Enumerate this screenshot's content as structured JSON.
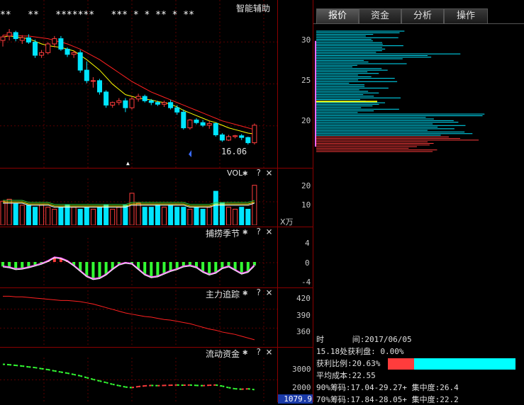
{
  "main_chart": {
    "title": "智能辅助",
    "stars": "**   **   *******   *** * * ** * **",
    "low_label": "16.06",
    "candles": [
      {
        "o": 28.0,
        "h": 28.6,
        "l": 27.3,
        "c": 28.4
      },
      {
        "o": 28.5,
        "h": 29.3,
        "l": 28.0,
        "c": 28.9
      },
      {
        "o": 28.9,
        "h": 29.1,
        "l": 27.9,
        "c": 28.2
      },
      {
        "o": 28.0,
        "h": 28.6,
        "l": 27.6,
        "c": 28.3
      },
      {
        "o": 28.3,
        "h": 28.7,
        "l": 27.6,
        "c": 27.8
      },
      {
        "o": 27.8,
        "h": 28.1,
        "l": 26.0,
        "c": 26.3
      },
      {
        "o": 26.3,
        "h": 26.9,
        "l": 26.0,
        "c": 26.6
      },
      {
        "o": 26.6,
        "h": 27.8,
        "l": 26.4,
        "c": 27.6
      },
      {
        "o": 27.6,
        "h": 28.5,
        "l": 27.2,
        "c": 28.2
      },
      {
        "o": 28.2,
        "h": 28.5,
        "l": 26.8,
        "c": 27.0
      },
      {
        "o": 27.0,
        "h": 27.2,
        "l": 26.1,
        "c": 26.4
      },
      {
        "o": 26.4,
        "h": 26.8,
        "l": 26.0,
        "c": 26.6
      },
      {
        "o": 26.6,
        "h": 26.9,
        "l": 24.3,
        "c": 24.6
      },
      {
        "o": 24.6,
        "h": 25.6,
        "l": 23.1,
        "c": 23.4
      },
      {
        "o": 23.4,
        "h": 23.8,
        "l": 22.6,
        "c": 23.4
      },
      {
        "o": 23.4,
        "h": 23.6,
        "l": 21.8,
        "c": 22.1
      },
      {
        "o": 22.1,
        "h": 22.3,
        "l": 20.3,
        "c": 20.6
      },
      {
        "o": 20.6,
        "h": 21.0,
        "l": 20.3,
        "c": 20.9
      },
      {
        "o": 20.9,
        "h": 21.4,
        "l": 20.6,
        "c": 21.1
      },
      {
        "o": 21.1,
        "h": 21.4,
        "l": 19.8,
        "c": 20.3
      },
      {
        "o": 20.3,
        "h": 21.6,
        "l": 20.1,
        "c": 21.3
      },
      {
        "o": 21.3,
        "h": 21.9,
        "l": 21.0,
        "c": 21.6
      },
      {
        "o": 21.6,
        "h": 21.8,
        "l": 20.9,
        "c": 21.1
      },
      {
        "o": 21.1,
        "h": 21.3,
        "l": 20.6,
        "c": 20.9
      },
      {
        "o": 20.9,
        "h": 21.1,
        "l": 20.5,
        "c": 20.7
      },
      {
        "o": 20.7,
        "h": 21.1,
        "l": 20.4,
        "c": 20.9
      },
      {
        "o": 20.9,
        "h": 21.2,
        "l": 20.1,
        "c": 20.3
      },
      {
        "o": 20.3,
        "h": 20.6,
        "l": 19.5,
        "c": 19.8
      },
      {
        "o": 19.8,
        "h": 20.1,
        "l": 17.8,
        "c": 18.0
      },
      {
        "o": 18.0,
        "h": 19.0,
        "l": 17.8,
        "c": 18.9
      },
      {
        "o": 18.9,
        "h": 19.1,
        "l": 18.4,
        "c": 18.6
      },
      {
        "o": 18.6,
        "h": 18.9,
        "l": 18.1,
        "c": 18.3
      },
      {
        "o": 18.3,
        "h": 18.8,
        "l": 17.9,
        "c": 18.5
      },
      {
        "o": 18.5,
        "h": 18.6,
        "l": 17.0,
        "c": 17.2
      },
      {
        "o": 17.2,
        "h": 17.4,
        "l": 16.4,
        "c": 16.6
      },
      {
        "o": 16.6,
        "h": 17.2,
        "l": 16.5,
        "c": 17.0
      },
      {
        "o": 17.0,
        "h": 17.2,
        "l": 16.8,
        "c": 17.1
      },
      {
        "o": 17.1,
        "h": 17.3,
        "l": 16.6,
        "c": 16.9
      },
      {
        "o": 16.9,
        "h": 17.0,
        "l": 16.1,
        "c": 16.3
      },
      {
        "o": 16.3,
        "h": 18.5,
        "l": 16.1,
        "c": 18.3
      }
    ],
    "ma_short": [
      28.4,
      28.5,
      28.4,
      28.3,
      28.2,
      27.9,
      27.6,
      27.4,
      27.3,
      27.2,
      27.0,
      26.8,
      26.3,
      25.8,
      25.2,
      24.6,
      23.8,
      23.0,
      22.4,
      21.8,
      21.6,
      21.4,
      21.3,
      21.2,
      21.0,
      20.9,
      20.7,
      20.4,
      20.0,
      19.7,
      19.4,
      19.1,
      18.8,
      18.6,
      18.3,
      18.0,
      17.8,
      17.6,
      17.4,
      17.3
    ],
    "ma_long": [
      28.6,
      28.6,
      28.6,
      28.5,
      28.5,
      28.4,
      28.3,
      28.2,
      28.0,
      27.8,
      27.6,
      27.3,
      27.0,
      26.6,
      26.2,
      25.8,
      25.3,
      24.8,
      24.3,
      23.8,
      23.3,
      22.9,
      22.5,
      22.1,
      21.8,
      21.5,
      21.2,
      20.9,
      20.6,
      20.3,
      20.0,
      19.7,
      19.4,
      19.1,
      18.8,
      18.6,
      18.4,
      18.2,
      18.0,
      17.8
    ]
  },
  "volume": {
    "title": "VOL",
    "unit": "X万",
    "y_ticks": [
      "20",
      "10"
    ],
    "values": [
      12,
      13,
      11,
      10,
      10,
      9,
      10,
      9,
      8,
      9,
      10,
      9,
      8,
      9,
      8,
      9,
      10,
      8,
      9,
      10,
      16,
      11,
      9,
      9,
      10,
      9,
      10,
      9,
      9,
      8,
      9,
      8,
      9,
      17,
      11,
      9,
      8,
      9,
      8,
      20
    ],
    "ma": [
      11,
      11,
      11,
      11,
      10,
      10,
      10,
      10,
      9,
      9,
      9,
      9,
      9,
      9,
      9,
      9,
      9,
      9,
      9,
      9,
      10,
      10,
      10,
      10,
      10,
      10,
      10,
      10,
      10,
      9,
      9,
      9,
      9,
      10,
      10,
      10,
      10,
      10,
      10,
      11
    ]
  },
  "season": {
    "title": "捕捞季节",
    "y_ticks": [
      "4",
      "0",
      "-4"
    ],
    "values": [
      -1.0,
      -1.2,
      -1.6,
      -1.5,
      -1.2,
      -0.8,
      -0.4,
      0.2,
      1.0,
      0.8,
      0.2,
      -0.8,
      -2.0,
      -3.2,
      -3.8,
      -3.6,
      -2.8,
      -1.6,
      -0.6,
      -0.2,
      -0.4,
      -1.6,
      -2.8,
      -3.4,
      -3.2,
      -2.6,
      -2.0,
      -1.6,
      -1.0,
      -0.8,
      -1.2,
      -2.2,
      -2.8,
      -2.4,
      -1.4,
      -1.0,
      -1.8,
      -2.6,
      -2.2,
      -0.8
    ],
    "line_a": [
      -0.9,
      -1.1,
      -1.5,
      -1.4,
      -1.1,
      -0.7,
      -0.3,
      0.3,
      1.1,
      0.9,
      0.3,
      -0.7,
      -1.9,
      -3.1,
      -3.7,
      -3.5,
      -2.7,
      -1.5,
      -0.5,
      -0.1,
      -0.3,
      -1.5,
      -2.7,
      -3.3,
      -3.1,
      -2.5,
      -1.9,
      -1.5,
      -0.9,
      -0.7,
      -1.1,
      -2.1,
      -2.7,
      -2.3,
      -1.3,
      -0.9,
      -1.7,
      -2.5,
      -2.1,
      -0.6
    ]
  },
  "trace": {
    "title": "主力追踪",
    "y_ticks": [
      "420",
      "390",
      "360"
    ],
    "values": [
      425,
      425,
      424,
      424,
      423,
      422,
      421,
      420,
      419,
      418,
      418,
      417,
      416,
      414,
      412,
      409,
      406,
      403,
      400,
      397,
      395,
      393,
      391,
      390,
      388,
      386,
      385,
      383,
      381,
      379,
      376,
      373,
      370,
      368,
      365,
      363,
      361,
      358,
      355,
      352
    ]
  },
  "flow": {
    "title": "流动资金",
    "y_ticks": [
      "3000",
      "2000"
    ],
    "current": "1079.9",
    "values": [
      3200,
      3180,
      3150,
      3120,
      3080,
      3050,
      3000,
      2960,
      2900,
      2850,
      2800,
      2740,
      2680,
      2600,
      2520,
      2450,
      2380,
      2300,
      2240,
      2180,
      2150,
      2200,
      2230,
      2250,
      2240,
      2250,
      2260,
      2270,
      2260,
      2270,
      2250,
      2240,
      2260,
      2270,
      2220,
      2150,
      2100,
      2080,
      2100,
      2060
    ]
  },
  "icons": {
    "gear": "✱",
    "help": "?",
    "close": "×"
  },
  "tabs": [
    "报价",
    "资金",
    "分析",
    "操作"
  ],
  "chip_dist": {
    "y_ticks": [
      "30",
      "25",
      "20"
    ],
    "y_min": 16.4,
    "y_max": 31.2,
    "current_price": 18.3,
    "avg_line": 22.55
  },
  "info": {
    "date_label": "时",
    "date_label2": "间:",
    "date_value": "2017/06/05",
    "profit_line": "15.18处获利盘: 0.00%",
    "ratio_line": "获利比例:20.63%",
    "ratio_value": 0.2063,
    "avg_cost": "平均成本:22.55",
    "chip90": "90%筹码:17.04-29.27+ 集中度:26.4",
    "chip70": "70%筹码:17.84-28.05+ 集中度:22.2"
  },
  "colors": {
    "up": "#ff3c3c",
    "down": "#00e5ff",
    "ma_short": "#ffff00",
    "ma_long": "#ff2020",
    "green": "#33ff33",
    "grid": "#5a0000"
  }
}
